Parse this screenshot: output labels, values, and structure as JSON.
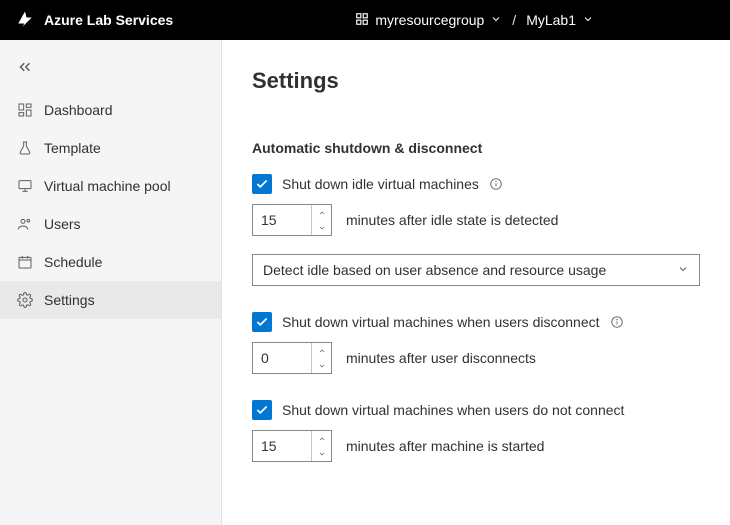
{
  "topbar": {
    "product_name": "Azure Lab Services",
    "breadcrumb": {
      "resource_group": "myresourcegroup",
      "lab": "MyLab1"
    }
  },
  "sidebar": {
    "items": [
      {
        "label": "Dashboard",
        "icon": "dashboard"
      },
      {
        "label": "Template",
        "icon": "flask"
      },
      {
        "label": "Virtual machine pool",
        "icon": "vm"
      },
      {
        "label": "Users",
        "icon": "users"
      },
      {
        "label": "Schedule",
        "icon": "schedule"
      },
      {
        "label": "Settings",
        "icon": "gear",
        "active": true
      }
    ]
  },
  "page": {
    "title": "Settings",
    "section": {
      "heading": "Automatic shutdown & disconnect",
      "opt1": {
        "label": "Shut down idle virtual machines",
        "value": "15",
        "hint": "minutes after idle state is detected",
        "dropdown": "Detect idle based on user absence and resource usage"
      },
      "opt2": {
        "label": "Shut down virtual machines when users disconnect",
        "value": "0",
        "hint": "minutes after user disconnects"
      },
      "opt3": {
        "label": "Shut down virtual machines when users do not connect",
        "value": "15",
        "hint": "minutes after machine is started"
      }
    }
  }
}
